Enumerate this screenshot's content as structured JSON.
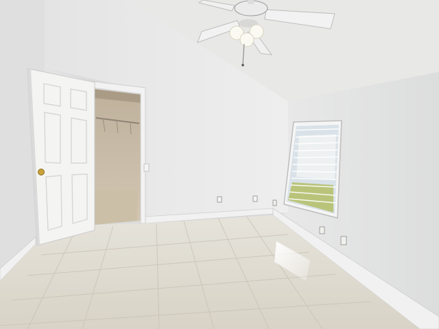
{
  "scene": {
    "palette": {
      "ceiling": "#e6e6e4",
      "wall_back": "#e9e9e9",
      "wall_left": "#dfdfdf",
      "wall_right": "#e2e3e3",
      "floor": "#dedad0",
      "door": "#f4f4f3",
      "door_shadow": "#c9c9c9",
      "closet_interior": "#c9bdad",
      "closet_floor": "#cbbfa8",
      "baseboard": "#f1f1f1",
      "grout": "#c7c2b5",
      "window_glass": "#d9e2e8",
      "window_blinds": "#f6f6f6",
      "lawn": "#b9c47a",
      "fan_blade": "#f2f2f2",
      "fan_light": "#fbfaf2",
      "door_knob": "#c9a23b"
    },
    "objects": [
      "ceiling-fan",
      "vaulted-ceiling",
      "open-door",
      "walk-in-closet",
      "window-with-blinds",
      "tile-floor",
      "baseboards",
      "electrical-outlets",
      "light-switch"
    ]
  }
}
